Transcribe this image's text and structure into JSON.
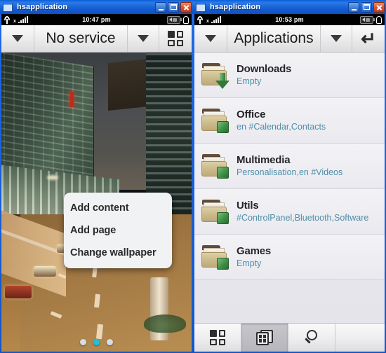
{
  "windows": [
    {
      "title": "hsapplication",
      "statusbar": {
        "time": "10:47 pm",
        "signal_icon": "no-signal-antenna-icon",
        "bars_icon": "signal-bars-icon",
        "battery_icon": "battery-icon",
        "voicemail_icon": "voicemail-icon"
      },
      "toolbar": {
        "left_caret": "caret-down-icon",
        "title": "No service",
        "right_caret": "caret-down-icon",
        "grid_button": "grid-view-icon"
      },
      "context_menu": {
        "items": [
          {
            "label": "Add content"
          },
          {
            "label": "Add page"
          },
          {
            "label": "Change wallpaper"
          }
        ]
      },
      "page_dots": {
        "count": 3,
        "active_index": 1
      },
      "wallpaper_alt": "night city street with cars"
    },
    {
      "title": "hsapplication",
      "statusbar": {
        "time": "10:53 pm",
        "signal_icon": "no-signal-antenna-icon",
        "bars_icon": "signal-bars-icon",
        "battery_icon": "battery-icon",
        "voicemail_icon": "voicemail-icon"
      },
      "toolbar": {
        "left_caret": "caret-down-icon",
        "title": "Applications",
        "right_caret": "caret-down-icon",
        "back_button": "back-arrow-icon"
      },
      "list": [
        {
          "title": "Downloads",
          "subtitle": "Empty",
          "icon": "folder-download-icon"
        },
        {
          "title": "Office",
          "subtitle": "en #Calendar,Contacts",
          "icon": "folder-icon"
        },
        {
          "title": "Multimedia",
          "subtitle": "Personalisation,en #Videos",
          "icon": "folder-icon"
        },
        {
          "title": "Utils",
          "subtitle": "#ControlPanel,Bluetooth,Software",
          "icon": "folder-icon"
        },
        {
          "title": "Games",
          "subtitle": "Empty",
          "icon": "folder-icon"
        }
      ],
      "bottom_toolbar": [
        {
          "icon": "grid-view-icon",
          "selected": false
        },
        {
          "icon": "stack-view-icon",
          "selected": true
        },
        {
          "icon": "search-icon",
          "selected": false
        }
      ]
    }
  ],
  "colors": {
    "titlebar_blue": "#1860d4",
    "accent_cyan": "#1fc0dd",
    "subtitle_teal": "#4f8fa8",
    "folder_tan": "#cdbd8e",
    "badge_green": "#3f8f48"
  }
}
